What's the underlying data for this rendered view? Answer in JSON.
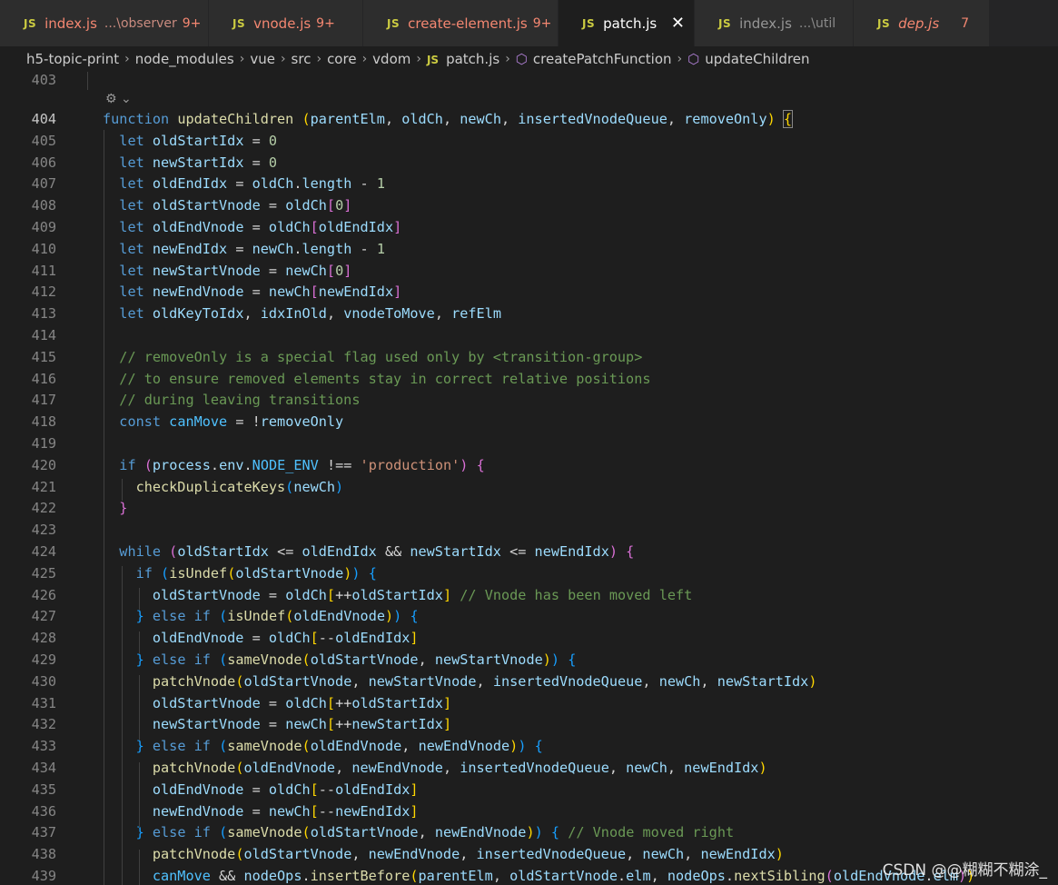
{
  "tabs": [
    {
      "name": "index.js",
      "desc": "...\\observer",
      "badge": "9+",
      "state": "error"
    },
    {
      "name": "vnode.js",
      "badge": "9+",
      "state": "error"
    },
    {
      "name": "create-element.js",
      "badge": "9+",
      "state": "error"
    },
    {
      "name": "patch.js",
      "state": "active",
      "close": "✕"
    },
    {
      "name": "index.js",
      "desc": "...\\util",
      "state": "normal"
    },
    {
      "name": "dep.js",
      "badge": "7",
      "state": "error-italic"
    }
  ],
  "breadcrumb": [
    "h5-topic-print",
    "node_modules",
    "vue",
    "src",
    "core",
    "vdom",
    "patch.js",
    "createPatchFunction",
    "updateChildren"
  ],
  "colors": {
    "keyword": "#569cd6",
    "function": "#dcdcaa",
    "variable": "#9cdcfe",
    "number": "#b5cea8",
    "string": "#ce9178",
    "comment": "#6a9955",
    "error": "#f48771",
    "js_badge": "#cbcb41"
  },
  "watermark": "CSDN @@糊糊不糊涂_",
  "lines": [
    {
      "n": "403",
      "html": ""
    },
    {
      "n": "404",
      "html": "<span class='kw'>function</span> <span class='fn'>updateChildren</span> <span class='b1'>(</span><span class='var'>parentElm</span>, <span class='var'>oldCh</span>, <span class='var'>newCh</span>, <span class='var'>insertedVnodeQueue</span>, <span class='var'>removeOnly</span><span class='b1'>)</span> <span class='b1 brk-hl'>{</span>"
    },
    {
      "n": "405",
      "html": "  <span class='kw'>let</span> <span class='var'>oldStartIdx</span> = <span class='num'>0</span>"
    },
    {
      "n": "406",
      "html": "  <span class='kw'>let</span> <span class='var'>newStartIdx</span> = <span class='num'>0</span>"
    },
    {
      "n": "407",
      "html": "  <span class='kw'>let</span> <span class='var'>oldEndIdx</span> = <span class='var'>oldCh</span>.<span class='var'>length</span> - <span class='num'>1</span>"
    },
    {
      "n": "408",
      "html": "  <span class='kw'>let</span> <span class='var'>oldStartVnode</span> = <span class='var'>oldCh</span><span class='b2'>[</span><span class='num'>0</span><span class='b2'>]</span>"
    },
    {
      "n": "409",
      "html": "  <span class='kw'>let</span> <span class='var'>oldEndVnode</span> = <span class='var'>oldCh</span><span class='b2'>[</span><span class='var'>oldEndIdx</span><span class='b2'>]</span>"
    },
    {
      "n": "410",
      "html": "  <span class='kw'>let</span> <span class='var'>newEndIdx</span> = <span class='var'>newCh</span>.<span class='var'>length</span> - <span class='num'>1</span>"
    },
    {
      "n": "411",
      "html": "  <span class='kw'>let</span> <span class='var'>newStartVnode</span> = <span class='var'>newCh</span><span class='b2'>[</span><span class='num'>0</span><span class='b2'>]</span>"
    },
    {
      "n": "412",
      "html": "  <span class='kw'>let</span> <span class='var'>newEndVnode</span> = <span class='var'>newCh</span><span class='b2'>[</span><span class='var'>newEndIdx</span><span class='b2'>]</span>"
    },
    {
      "n": "413",
      "html": "  <span class='kw'>let</span> <span class='var'>oldKeyToIdx</span>, <span class='var'>idxInOld</span>, <span class='var'>vnodeToMove</span>, <span class='var'>refElm</span>"
    },
    {
      "n": "414",
      "html": ""
    },
    {
      "n": "415",
      "html": "  <span class='cm'>// removeOnly is a special flag used only by &lt;transition-group&gt;</span>"
    },
    {
      "n": "416",
      "html": "  <span class='cm'>// to ensure removed elements stay in correct relative positions</span>"
    },
    {
      "n": "417",
      "html": "  <span class='cm'>// during leaving transitions</span>"
    },
    {
      "n": "418",
      "html": "  <span class='kw'>const</span> <span class='const'>canMove</span> = !<span class='var'>removeOnly</span>"
    },
    {
      "n": "419",
      "html": ""
    },
    {
      "n": "420",
      "html": "  <span class='kw'>if</span> <span class='b2'>(</span><span class='var'>process</span>.<span class='var'>env</span>.<span class='const'>NODE_ENV</span> !== <span class='str'>'production'</span><span class='b2'>)</span> <span class='b2'>{</span>"
    },
    {
      "n": "421",
      "html": "    <span class='fn'>checkDuplicateKeys</span><span class='b3'>(</span><span class='var'>newCh</span><span class='b3'>)</span>"
    },
    {
      "n": "422",
      "html": "  <span class='b2'>}</span>"
    },
    {
      "n": "423",
      "html": ""
    },
    {
      "n": "424",
      "html": "  <span class='kw'>while</span> <span class='b2'>(</span><span class='var'>oldStartIdx</span> &lt;= <span class='var'>oldEndIdx</span> &amp;&amp; <span class='var'>newStartIdx</span> &lt;= <span class='var'>newEndIdx</span><span class='b2'>)</span> <span class='b2'>{</span>"
    },
    {
      "n": "425",
      "html": "    <span class='kw'>if</span> <span class='b3'>(</span><span class='fn'>isUndef</span><span class='b1'>(</span><span class='var'>oldStartVnode</span><span class='b1'>)</span><span class='b3'>)</span> <span class='b3'>{</span>"
    },
    {
      "n": "426",
      "html": "      <span class='var'>oldStartVnode</span> = <span class='var'>oldCh</span><span class='b1'>[</span>++<span class='var'>oldStartIdx</span><span class='b1'>]</span> <span class='cm'>// Vnode has been moved left</span>"
    },
    {
      "n": "427",
      "html": "    <span class='b3'>}</span> <span class='kw'>else</span> <span class='kw'>if</span> <span class='b3'>(</span><span class='fn'>isUndef</span><span class='b1'>(</span><span class='var'>oldEndVnode</span><span class='b1'>)</span><span class='b3'>)</span> <span class='b3'>{</span>"
    },
    {
      "n": "428",
      "html": "      <span class='var'>oldEndVnode</span> = <span class='var'>oldCh</span><span class='b1'>[</span>--<span class='var'>oldEndIdx</span><span class='b1'>]</span>"
    },
    {
      "n": "429",
      "html": "    <span class='b3'>}</span> <span class='kw'>else</span> <span class='kw'>if</span> <span class='b3'>(</span><span class='fn'>sameVnode</span><span class='b1'>(</span><span class='var'>oldStartVnode</span>, <span class='var'>newStartVnode</span><span class='b1'>)</span><span class='b3'>)</span> <span class='b3'>{</span>"
    },
    {
      "n": "430",
      "html": "      <span class='fn'>patchVnode</span><span class='b1'>(</span><span class='var'>oldStartVnode</span>, <span class='var'>newStartVnode</span>, <span class='var'>insertedVnodeQueue</span>, <span class='var'>newCh</span>, <span class='var'>newStartIdx</span><span class='b1'>)</span>"
    },
    {
      "n": "431",
      "html": "      <span class='var'>oldStartVnode</span> = <span class='var'>oldCh</span><span class='b1'>[</span>++<span class='var'>oldStartIdx</span><span class='b1'>]</span>"
    },
    {
      "n": "432",
      "html": "      <span class='var'>newStartVnode</span> = <span class='var'>newCh</span><span class='b1'>[</span>++<span class='var'>newStartIdx</span><span class='b1'>]</span>"
    },
    {
      "n": "433",
      "html": "    <span class='b3'>}</span> <span class='kw'>else</span> <span class='kw'>if</span> <span class='b3'>(</span><span class='fn'>sameVnode</span><span class='b1'>(</span><span class='var'>oldEndVnode</span>, <span class='var'>newEndVnode</span><span class='b1'>)</span><span class='b3'>)</span> <span class='b3'>{</span>"
    },
    {
      "n": "434",
      "html": "      <span class='fn'>patchVnode</span><span class='b1'>(</span><span class='var'>oldEndVnode</span>, <span class='var'>newEndVnode</span>, <span class='var'>insertedVnodeQueue</span>, <span class='var'>newCh</span>, <span class='var'>newEndIdx</span><span class='b1'>)</span>"
    },
    {
      "n": "435",
      "html": "      <span class='var'>oldEndVnode</span> = <span class='var'>oldCh</span><span class='b1'>[</span>--<span class='var'>oldEndIdx</span><span class='b1'>]</span>"
    },
    {
      "n": "436",
      "html": "      <span class='var'>newEndVnode</span> = <span class='var'>newCh</span><span class='b1'>[</span>--<span class='var'>newEndIdx</span><span class='b1'>]</span>"
    },
    {
      "n": "437",
      "html": "    <span class='b3'>}</span> <span class='kw'>else</span> <span class='kw'>if</span> <span class='b3'>(</span><span class='fn'>sameVnode</span><span class='b1'>(</span><span class='var'>oldStartVnode</span>, <span class='var'>newEndVnode</span><span class='b1'>)</span><span class='b3'>)</span> <span class='b3'>{</span> <span class='cm'>// Vnode moved right</span>"
    },
    {
      "n": "438",
      "html": "      <span class='fn'>patchVnode</span><span class='b1'>(</span><span class='var'>oldStartVnode</span>, <span class='var'>newEndVnode</span>, <span class='var'>insertedVnodeQueue</span>, <span class='var'>newCh</span>, <span class='var'>newEndIdx</span><span class='b1'>)</span>"
    },
    {
      "n": "439",
      "html": "      <span class='const'>canMove</span> &amp;&amp; <span class='var'>nodeOps</span>.<span class='fn'>insertBefore</span><span class='b1'>(</span><span class='var'>parentElm</span>, <span class='var'>oldStartVnode</span>.<span class='var'>elm</span>, <span class='var'>nodeOps</span>.<span class='fn'>nextSibling</span><span class='b2'>(</span><span class='var'>oldEndVnode</span>.<span class='var'>elm</span><span class='b2'>)</span><span class='b1'>)</span>"
    }
  ]
}
